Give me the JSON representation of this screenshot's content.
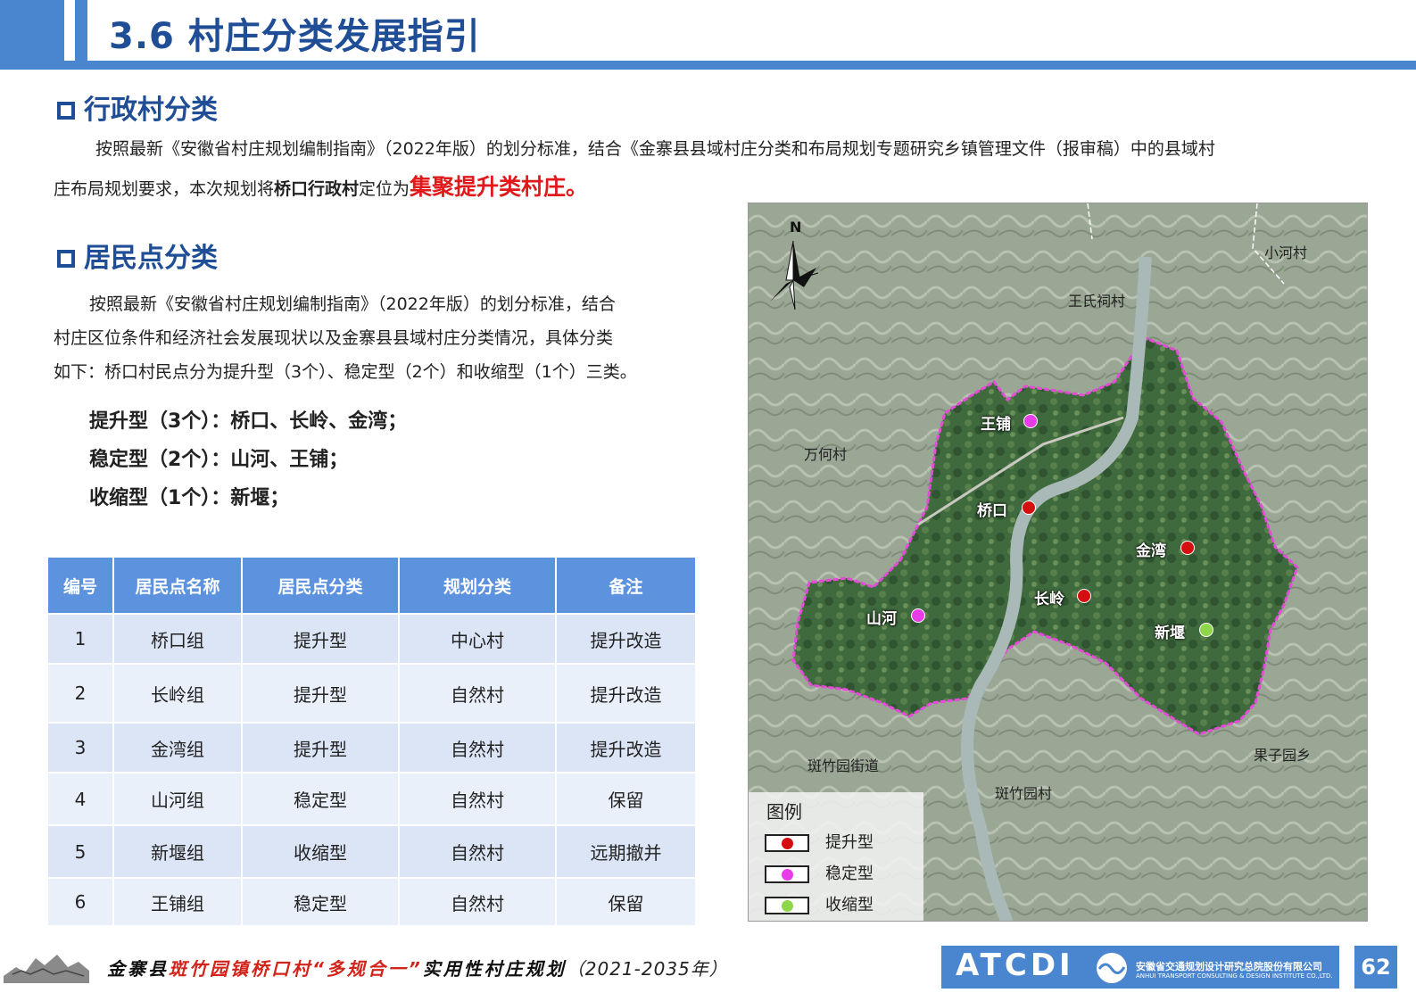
{
  "header": {
    "title": "3.6 村庄分类发展指引"
  },
  "section1": {
    "heading": "行政村分类",
    "para_line1": "按照最新《安徽省村庄规划编制指南》（2022年版）的划分标准，结合《金寨县县域村庄分类和布局规划专题研究乡镇管理文件（报审稿）中的县域村",
    "para_line2_a": "庄布局规划要求，本次规划将",
    "para_line2_b": "桥口行政村",
    "para_line2_c": "定位为",
    "para_line2_d": "集聚提升类村庄。"
  },
  "section2": {
    "heading": "居民点分类",
    "lines": [
      "按照最新《安徽省村庄规划编制指南》（2022年版）的划分标准，结合",
      "村庄区位条件和经济社会发展现状以及金寨县县域村庄分类情况，具体分类",
      "如下：桥口村民点分为提升型（3个）、稳定型（2个）和收缩型（1个）三类。"
    ],
    "categories": [
      "提升型（3个）：桥口、长岭、金湾；",
      "稳定型（2个）：山河、王铺；",
      "收缩型（1个）：新堰；"
    ]
  },
  "table": {
    "headers": [
      "编号",
      "居民点名称",
      "居民点分类",
      "规划分类",
      "备注"
    ],
    "rows": [
      [
        "1",
        "桥口组",
        "提升型",
        "中心村",
        "提升改造"
      ],
      [
        "2",
        "长岭组",
        "提升型",
        "自然村",
        "提升改造"
      ],
      [
        "3",
        "金湾组",
        "提升型",
        "自然村",
        "提升改造"
      ],
      [
        "4",
        "山河组",
        "稳定型",
        "自然村",
        "保留"
      ],
      [
        "5",
        "新堰组",
        "收缩型",
        "自然村",
        "远期撤并"
      ],
      [
        "6",
        "王铺组",
        "稳定型",
        "自然村",
        "保留"
      ]
    ]
  },
  "map": {
    "north": "N",
    "areas": [
      "小河村",
      "王氏祠村",
      "万何村",
      "斑竹园街道",
      "斑竹园村",
      "果子园乡"
    ],
    "villages": [
      "王铺",
      "桥口",
      "金湾",
      "长岭",
      "山河",
      "新堰"
    ],
    "legend": {
      "title": "图例",
      "items": [
        {
          "label": "提升型",
          "color": "#d40f0f"
        },
        {
          "label": "稳定型",
          "color": "#e83ce8"
        },
        {
          "label": "收缩型",
          "color": "#8ed64a"
        }
      ]
    }
  },
  "footer": {
    "county": "金寨县",
    "title_red": "斑竹园镇桥口村“多规合一”",
    "title_black": "实用性村庄规划",
    "years": "（2021-2035年）",
    "company_logo": "ATCDI",
    "company_cn": "安徽省交通规划设计研究总院股份有限公司",
    "company_en": "ANHUI TRANSPORT CONSULTING & DESIGN INSTITUTE CO.,LTD.",
    "page": "62"
  }
}
